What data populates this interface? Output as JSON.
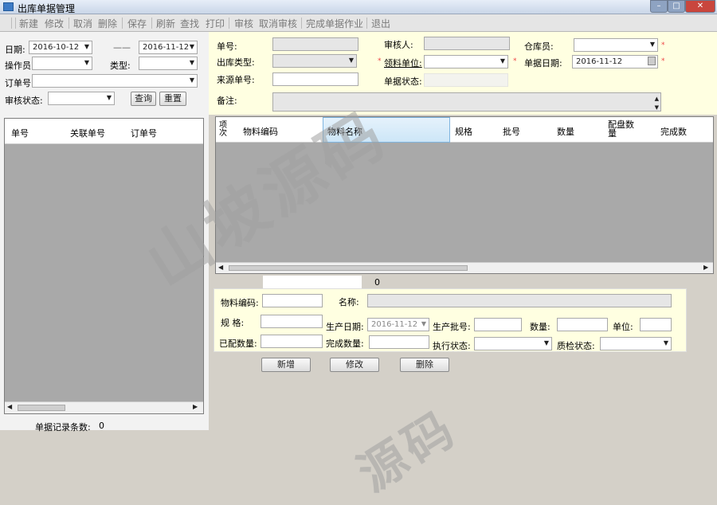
{
  "window": {
    "title": "出库单据管理"
  },
  "toolbar": {
    "items": [
      "新建",
      "修改",
      "取消",
      "删除",
      "保存",
      "刷新",
      "查找",
      "打印",
      "审核",
      "取消审核",
      "完成单据作业",
      "退出"
    ]
  },
  "filter": {
    "date_label": "日期:",
    "date_from": "2016-10-12",
    "date_sep": "——",
    "date_to": "2016-11-12",
    "operator_label": "操作员",
    "type_label": "类型:",
    "order_label": "订单号",
    "status_label": "审核状态:",
    "query_button": "查询",
    "reset_button": "重置"
  },
  "left_grid": {
    "columns": [
      "单号",
      "关联单号",
      "订单号"
    ],
    "footer_label": "单据记录条数:",
    "footer_count": "0"
  },
  "header_form": {
    "no_label": "单号:",
    "reviewer_label": "审核人:",
    "keeper_label": "仓库员:",
    "out_type_label": "出库类型:",
    "receiver_unit_label": "领料单位:",
    "doc_date_label": "单据日期:",
    "doc_date": "2016-11-12",
    "source_no_label": "来源单号:",
    "doc_status_label": "单据状态:",
    "remark_label": "备注:"
  },
  "detail_grid": {
    "columns": [
      "项次",
      "物料编码",
      "物料名称",
      "规格",
      "批号",
      "数量",
      "配盘数量",
      "完成数"
    ],
    "count_value": "0"
  },
  "detail_form": {
    "material_code_label": "物料编码:",
    "name_label": "名称:",
    "spec_label": "规 格:",
    "prod_date_label": "生产日期:",
    "prod_date": "2016-11-12",
    "batch_label": "生产批号:",
    "qty_label": "数量:",
    "unit_label": "单位:",
    "matched_qty_label": "已配数量:",
    "done_qty_label": "完成数量:",
    "exec_status_label": "执行状态:",
    "qc_status_label": "质检状态:"
  },
  "actions": {
    "add": "新增",
    "edit": "修改",
    "delete": "删除"
  },
  "watermarks": {
    "text1": "山坡源码",
    "text2": "源码"
  }
}
